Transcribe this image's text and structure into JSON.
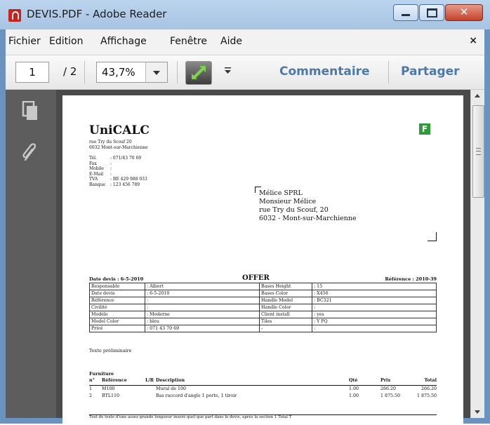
{
  "window": {
    "title": "DEVIS.PDF - Adobe Reader"
  },
  "menu": {
    "items": [
      "Fichier",
      "Edition",
      "Affichage",
      "Fenêtre",
      "Aide"
    ],
    "close": "×"
  },
  "toolbar": {
    "page": "1",
    "page_total": "/ 2",
    "zoom": "43,7%",
    "comment": "Commentaire",
    "share": "Partager"
  },
  "doc": {
    "company": "UniCALC",
    "address": [
      "rue Try du Scouf 20",
      "6032 Mont-sur-Marchienne"
    ],
    "contact": [
      {
        "k": "Tél.",
        "v": ": 071/43 70 69"
      },
      {
        "k": "Fax",
        "v": ":"
      },
      {
        "k": "Mobile",
        "v": ":"
      },
      {
        "k": "E-Mail",
        "v": ":"
      },
      {
        "k": "TVA",
        "v": ": BE 429 988 033"
      },
      {
        "k": "Banque",
        "v": ": 123 456 789"
      }
    ],
    "recipient": [
      "Mélice SPRL",
      "Monsieur Mélice",
      "rue Try du Scouf, 20",
      "6032 - Mont-sur-Marchienne"
    ],
    "date_label": "Date devis : 6-5-2010",
    "offer_title": "OFFER",
    "ref_label": "Référence : 2010-39",
    "info_rows": [
      [
        "Responsable",
        ": Albert",
        "Bases Height",
        ": 15"
      ],
      [
        "Date devis",
        ": 6-5-2010",
        "Bases Color",
        ": X456"
      ],
      [
        "Référence",
        ":",
        "Handle Model",
        ": BC321"
      ],
      [
        "Civilité",
        ":",
        "Handle Color",
        ":"
      ],
      [
        "Modèle",
        ": Moderne",
        "Client install",
        ": yes"
      ],
      [
        "Model Color",
        ": bleu",
        "Tiles",
        ": Y PQ"
      ],
      [
        "Privé",
        ": 071 43 70 69",
        "-",
        ":"
      ]
    ],
    "prelim": "Texte préliminaire",
    "furniture_title": "Furniture",
    "furniture_head": {
      "n": "n°",
      "ref": "Référence",
      "lr": "L/R",
      "desc": "Description",
      "qty": "Qté",
      "price": "Prix",
      "total": "Total"
    },
    "furniture_rows": [
      {
        "n": "1",
        "ref": "M100",
        "desc": "Mural de 100",
        "qty": "1.00",
        "price": "266.20",
        "total": "266.20"
      },
      {
        "n": "2",
        "ref": "BTL110",
        "desc": "Bas raccord d'angle 1 porte, 1 tiroir",
        "qty": "1.00",
        "price": "1 875.50",
        "total": "1 875.50"
      }
    ],
    "footer": "Text de texte d'une assez grande longueur inséré quel que part dans le devis, après la section 1 Total T"
  }
}
